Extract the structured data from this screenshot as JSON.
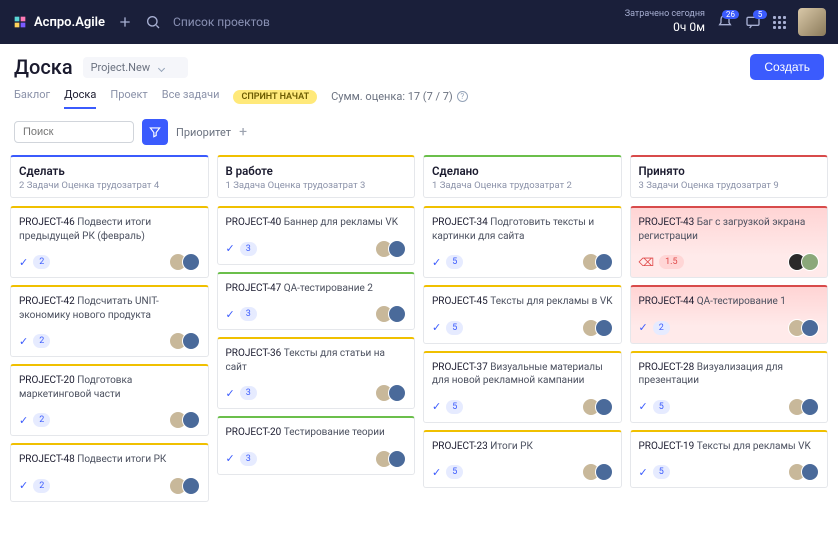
{
  "topbar": {
    "app_name": "Аспро.Agile",
    "search_placeholder": "Список проектов",
    "time_label": "Затрачено сегодня",
    "time_value": "0ч 0м",
    "notif_badge": "26",
    "chat_badge": "5"
  },
  "page": {
    "title": "Доска",
    "project": "Project.New",
    "create_btn": "Создать"
  },
  "tabs": [
    "Баклог",
    "Доска",
    "Проект",
    "Все задачи"
  ],
  "sprint_chip": "СПРИНТ НАЧАТ",
  "estimate_summary": "Сумм. оценка:  17  (7 / 7)",
  "filters": {
    "search_placeholder": "Поиск",
    "priority_label": "Приоритет"
  },
  "columns": [
    {
      "title": "Сделать",
      "meta": "2 Задачи   Оценка трудозатрат 4",
      "accent": "#3b5bfd",
      "cards": [
        {
          "key": "PROJECT-46",
          "text": "Подвести итоги предыдущей РК (февраль)",
          "est": 2,
          "accent": "#f0c000",
          "avatars": [
            "a",
            "b"
          ]
        },
        {
          "key": "PROJECT-42",
          "text": "Подсчитать UNIT-экономику нового продукта",
          "est": 2,
          "accent": "#f0c000",
          "avatars": [
            "a",
            "b"
          ]
        },
        {
          "key": "PROJECT-20",
          "text": "Подготовка маркетинговой части",
          "est": 2,
          "accent": "#f0c000",
          "avatars": [
            "a",
            "b"
          ]
        },
        {
          "key": "PROJECT-48",
          "text": "Подвести итоги РК",
          "est": 2,
          "accent": "#f0c000",
          "avatars": [
            "a",
            "b"
          ]
        }
      ]
    },
    {
      "title": "В работе",
      "meta": "1 Задача   Оценка трудозатрат 3",
      "accent": "#f0c000",
      "cards": [
        {
          "key": "PROJECT-40",
          "text": "Баннер для рекламы VK",
          "est": 3,
          "accent": "#f0c000",
          "avatars": [
            "a",
            "b"
          ]
        },
        {
          "key": "PROJECT-47",
          "text": "QA-тестирование 2",
          "est": 3,
          "accent": "#6bbf4b",
          "avatars": [
            "a",
            "b"
          ]
        },
        {
          "key": "PROJECT-36",
          "text": "Тексты для статьи на сайт",
          "est": 3,
          "accent": "#f0c000",
          "avatars": [
            "a",
            "b"
          ]
        },
        {
          "key": "PROJECT-20",
          "text": "Тестирование теории",
          "est": 3,
          "accent": "#6bbf4b",
          "avatars": [
            "a",
            "b"
          ]
        }
      ]
    },
    {
      "title": "Сделано",
      "meta": "1 Задача   Оценка трудозатрат 2",
      "accent": "#6bbf4b",
      "cards": [
        {
          "key": "PROJECT-34",
          "text": "Подготовить тексты и картинки для сайта",
          "est": 5,
          "accent": "#f0c000",
          "avatars": [
            "a",
            "b"
          ]
        },
        {
          "key": "PROJECT-45",
          "text": "Тексты для рекламы в VK",
          "est": 5,
          "accent": "#f0c000",
          "avatars": [
            "a",
            "b"
          ]
        },
        {
          "key": "PROJECT-37",
          "text": "Визуальные материалы для новой рекламной кампании",
          "est": 5,
          "accent": "#f0c000",
          "avatars": [
            "a",
            "b"
          ]
        },
        {
          "key": "PROJECT-23",
          "text": "Итоги РК",
          "est": 5,
          "accent": "#f0c000",
          "avatars": [
            "a",
            "b"
          ]
        }
      ]
    },
    {
      "title": "Принято",
      "meta": "3 Задачи   Оценка трудозатрат 9",
      "accent": "#d84b4b",
      "cards": [
        {
          "key": "PROJECT-43",
          "text": "Баг с загрузкой экрана регистрации",
          "est": "1.5",
          "accent": "#d84b4b",
          "avatars": [
            "c",
            "d"
          ],
          "bug": true,
          "red": true
        },
        {
          "key": "PROJECT-44",
          "text": "QA-тестирование 1",
          "est": 2,
          "accent": "#d84b4b",
          "avatars": [
            "a",
            "b"
          ],
          "red": true
        },
        {
          "key": "PROJECT-28",
          "text": "Визуализация для презентации",
          "est": 5,
          "accent": "#f0c000",
          "avatars": [
            "a",
            "b"
          ]
        },
        {
          "key": "PROJECT-19",
          "text": "Тексты для рекламы VK",
          "est": 5,
          "accent": "#f0c000",
          "avatars": [
            "a",
            "b"
          ]
        }
      ]
    }
  ]
}
